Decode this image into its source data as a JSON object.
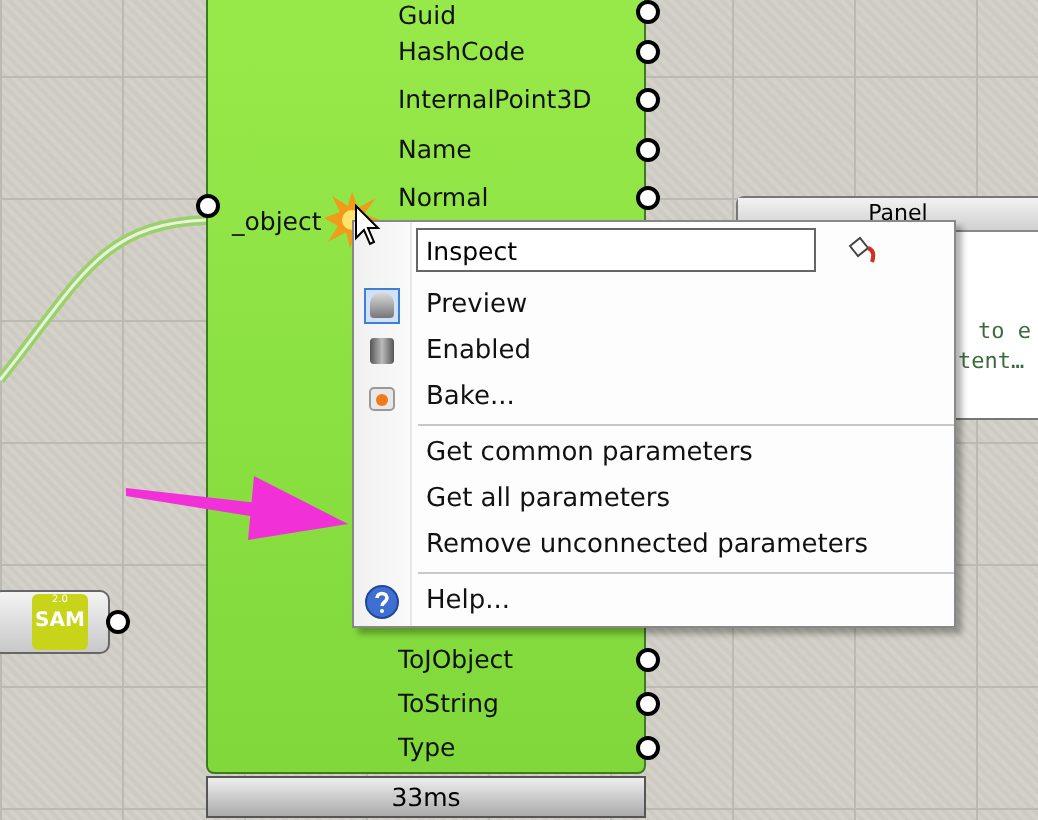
{
  "component": {
    "input": "_object",
    "outputs_above": [
      "Guid",
      "HashCode",
      "InternalPoint3D",
      "Name",
      "Normal"
    ],
    "outputs_below": [
      "ToJObject",
      "ToString",
      "Type"
    ],
    "timer": "33ms"
  },
  "sam_component": {
    "version": "2.0",
    "label": "SAM"
  },
  "panel": {
    "title": "Panel",
    "lines": [
      "to e",
      "tent…"
    ]
  },
  "context_menu": {
    "search": {
      "value": "Inspect"
    },
    "items": [
      {
        "kind": "check",
        "label": "Preview",
        "checked": true
      },
      {
        "kind": "check",
        "label": "Enabled",
        "checked": false
      },
      {
        "kind": "action",
        "label": "Bake..."
      },
      {
        "kind": "separator"
      },
      {
        "kind": "plain",
        "label": "Get common parameters"
      },
      {
        "kind": "plain",
        "label": "Get all parameters"
      },
      {
        "kind": "plain",
        "label": "Remove unconnected parameters"
      },
      {
        "kind": "separator"
      },
      {
        "kind": "help",
        "label": "Help..."
      }
    ]
  }
}
